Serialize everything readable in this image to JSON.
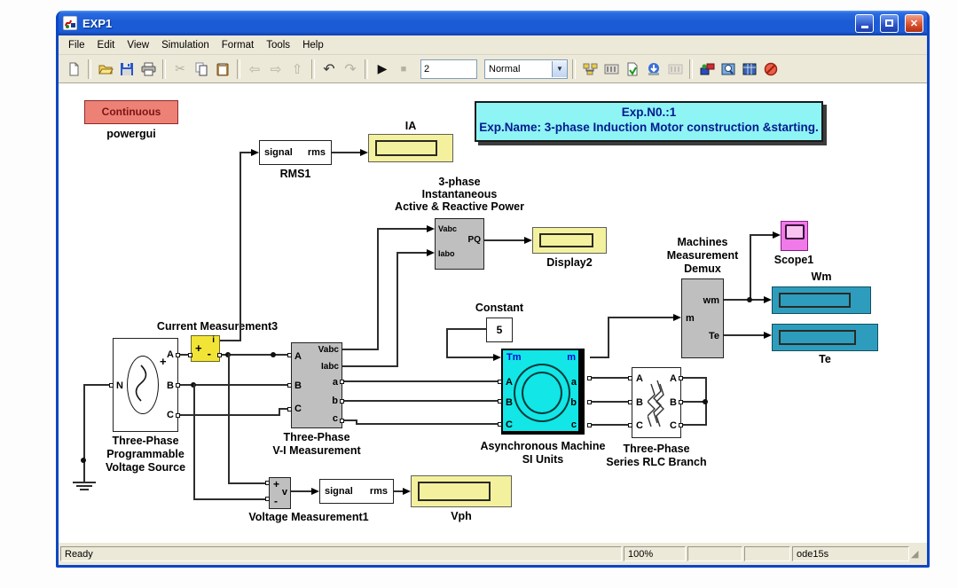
{
  "window": {
    "title": "EXP1"
  },
  "menubar": {
    "items": [
      "File",
      "Edit",
      "View",
      "Simulation",
      "Format",
      "Tools",
      "Help"
    ]
  },
  "toolbar": {
    "sim_stop_time": "2",
    "mode_select": "Normal",
    "icons": [
      "new-model",
      "open-model",
      "save-model",
      "print",
      "cut",
      "copy",
      "paste",
      "navigate-back",
      "navigate-forward",
      "navigate-up",
      "undo",
      "redo",
      "start-simulation",
      "stop-simulation",
      "library-browser",
      "model-browser",
      "update-diagram",
      "build-all",
      "viewer-disabled",
      "simulink-library",
      "model-explorer",
      "workspace-view",
      "debug"
    ]
  },
  "statusbar": {
    "status": "Ready",
    "zoom": "100%",
    "solver": "ode15s"
  },
  "colors": {
    "titlebar_blue": "#1b5cd6",
    "chrome_tan": "#ece9d8",
    "canvas_white": "#ffffff",
    "powergui_pink": "#ee8176",
    "display_yellow": "#f4f19e",
    "display_teal": "#2e9dbd",
    "scope_magenta": "#ef7ae8",
    "machine_cyan": "#12e6e6",
    "measurement_yellow": "#f2e436",
    "block_gray": "#bfbfbf",
    "title_box_cyan": "#8ef4f4",
    "title_text_navy": "#041a90"
  },
  "diagram": {
    "powergui": {
      "text": "Continuous",
      "label": "powergui"
    },
    "title_box": {
      "line1": "Exp.N0.:1",
      "line2": "Exp.Name: 3-phase Induction Motor construction &starting."
    },
    "rms1": {
      "in": "signal",
      "out": "rms",
      "label": "RMS1"
    },
    "display_ia": {
      "label": "IA"
    },
    "power_block": {
      "label1": "3-phase",
      "label2": "Instantaneous",
      "label3": "Active & Reactive Power",
      "port_vabc": "Vabc",
      "port_iabc": "Iabo",
      "port_pq": "PQ"
    },
    "display2": {
      "label": "Display2"
    },
    "constant": {
      "value": "5",
      "label": "Constant"
    },
    "current_measurement": {
      "label": "Current Measurement3",
      "port_i": "i",
      "plus": "+",
      "minus": "-"
    },
    "source": {
      "label1": "Three-Phase",
      "label2": "Programmable",
      "label3": "Voltage Source",
      "port_n": "N",
      "port_a": "A",
      "port_b": "B",
      "port_c": "C",
      "plus": "+"
    },
    "vi_measurement": {
      "label1": "Three-Phase",
      "label2": "V-I Measurement",
      "port_A": "A",
      "port_B": "B",
      "port_C": "C",
      "port_vabc": "Vabc",
      "port_iabc": "Iabc",
      "port_a": "a",
      "port_b": "b",
      "port_c": "c"
    },
    "async_machine": {
      "label1": "Asynchronous Machine",
      "label2": "SI Units",
      "port_tm": "Tm",
      "port_m": "m",
      "port_A": "A",
      "port_B": "B",
      "port_C": "C",
      "port_a": "a",
      "port_b": "b",
      "port_c": "c"
    },
    "rlc_branch": {
      "label1": "Three-Phase",
      "label2": "Series RLC Branch",
      "port_A": "A",
      "port_B": "B",
      "port_C": "C",
      "port_A2": "A",
      "port_B2": "B",
      "port_C2": "C"
    },
    "demux": {
      "label1": "Machines",
      "label2": "Measurement",
      "label3": "Demux",
      "port_m": "m",
      "port_wm": "wm",
      "port_te": "Te"
    },
    "scope": {
      "label": "Scope1"
    },
    "display_wm": {
      "label": "Wm"
    },
    "display_te": {
      "label": "Te"
    },
    "voltage_measurement": {
      "label": "Voltage Measurement1",
      "plus": "+",
      "minus": "-",
      "port_v": "v"
    },
    "rms2": {
      "in": "signal",
      "out": "rms"
    },
    "display_vph": {
      "label": "Vph"
    }
  }
}
